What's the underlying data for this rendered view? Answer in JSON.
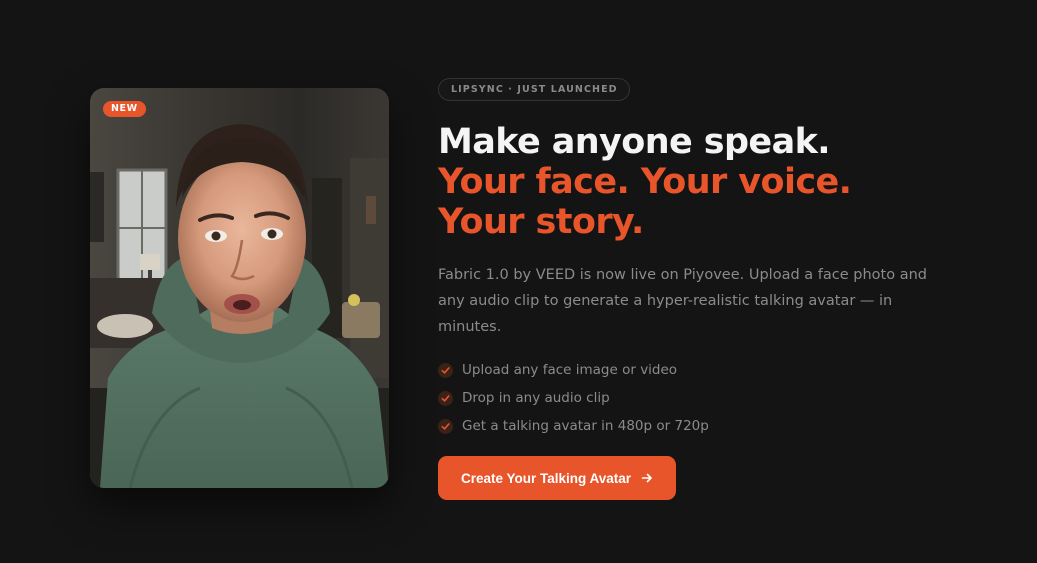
{
  "hero": {
    "badge": "NEW",
    "eyebrow": "LIPSYNC · JUST LAUNCHED",
    "headline_line1": "Make anyone speak.",
    "headline_line2": "Your face. Your voice. Your story.",
    "description": "Fabric 1.0 by VEED is now live on Piyovee. Upload a face photo and any audio clip to generate a hyper-realistic talking avatar — in minutes.",
    "features": [
      {
        "label": "Upload any face image or video",
        "icon": "check-icon"
      },
      {
        "label": "Drop in any audio clip",
        "icon": "check-icon"
      },
      {
        "label": "Get a talking avatar in 480p or 720p",
        "icon": "check-icon"
      }
    ],
    "cta_label": "Create Your Talking Avatar",
    "cta_icon": "arrow-right-icon"
  },
  "colors": {
    "background": "#141414",
    "accent": "#e8552a",
    "headline": "#f4f4f4",
    "body_text": "#8b8b8b"
  }
}
